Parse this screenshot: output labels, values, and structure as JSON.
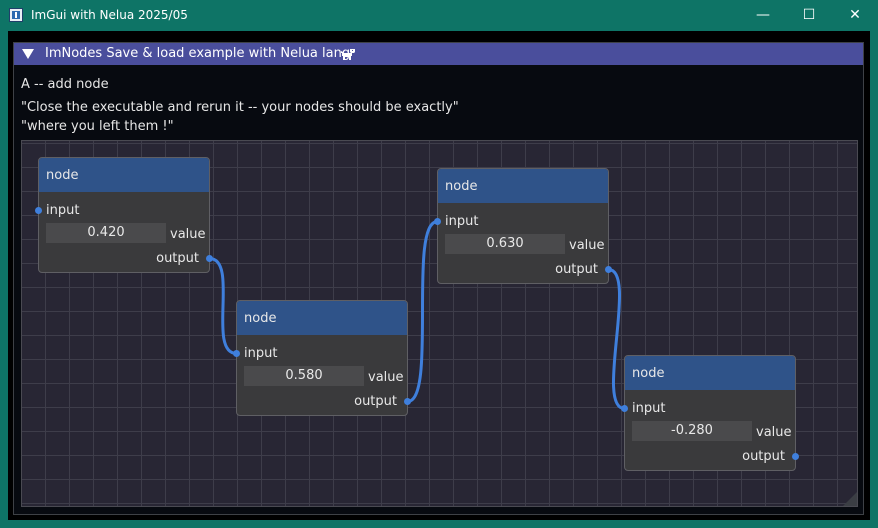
{
  "window": {
    "title": "ImGui with Nelua 2025/05",
    "controls": {
      "minimize": "—",
      "maximize": "☐",
      "close": "✕"
    }
  },
  "imgui_window": {
    "title": "ImNodes Save & load example with Nelua lang",
    "title_icon": "dog-icon"
  },
  "help": {
    "line1": "A -- add node",
    "line2": "\"Close the executable and rerun it -- your nodes should be exactly\"",
    "line3": "\"where you left them !\""
  },
  "nodes": [
    {
      "title": "node",
      "input_label": "input",
      "value": "0.420",
      "value_label": "value",
      "output_label": "output"
    },
    {
      "title": "node",
      "input_label": "input",
      "value": "0.580",
      "value_label": "value",
      "output_label": "output"
    },
    {
      "title": "node",
      "input_label": "input",
      "value": "0.630",
      "value_label": "value",
      "output_label": "output"
    },
    {
      "title": "node",
      "input_label": "input",
      "value": "-0.280",
      "value_label": "value",
      "output_label": "output"
    }
  ],
  "links": [
    {
      "from_node": 0,
      "to_node": 1
    },
    {
      "from_node": 1,
      "to_node": 2
    },
    {
      "from_node": 2,
      "to_node": 3
    }
  ],
  "colors": {
    "os_titlebar": "#0e7466",
    "imgui_titlebar": "#4a4e9c",
    "node_header": "#2f5389",
    "pin": "#3f7fdc",
    "link": "#3f7fdc",
    "grid_bg": "#282634"
  }
}
